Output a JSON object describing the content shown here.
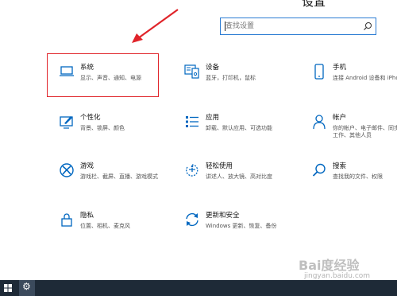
{
  "header": {
    "title_fragment": "设置"
  },
  "search": {
    "placeholder": "查找设置"
  },
  "categories": [
    {
      "title": "系统",
      "desc": "显示、声音、通知、电源",
      "icon": "laptop-icon"
    },
    {
      "title": "设备",
      "desc": "蓝牙，打印机，鼠标",
      "icon": "devices-icon"
    },
    {
      "title": "手机",
      "desc": "连接 Android 设备和 iPhone",
      "icon": "phone-icon"
    },
    {
      "title": "个性化",
      "desc": "背景、锁屏、颜色",
      "icon": "personalization-icon"
    },
    {
      "title": "应用",
      "desc": "卸载、默认应用、可选功能",
      "icon": "apps-icon"
    },
    {
      "title": "帐户",
      "desc": "你的帐户、电子邮件、同步设置、工作、其他人员",
      "icon": "account-icon"
    },
    {
      "title": "游戏",
      "desc": "游戏栏、截屏、直播、游戏模式",
      "icon": "xbox-icon"
    },
    {
      "title": "轻松使用",
      "desc": "讲述人、放大镜、高对比度",
      "icon": "ease-of-access-icon"
    },
    {
      "title": "搜索",
      "desc": "查找我的文件、权限",
      "icon": "search-icon"
    },
    {
      "title": "隐私",
      "desc": "位置、相机、麦克风",
      "icon": "lock-icon"
    },
    {
      "title": "更新和安全",
      "desc": "Windows 更新、恢复、备份",
      "icon": "update-icon"
    }
  ],
  "watermark": {
    "logo_text": "Bai度经验",
    "url": "jingyan.baidu.com"
  },
  "colors": {
    "accent": "#0067c0",
    "highlight": "#e0242a",
    "arrow": "#e0242a",
    "taskbar": "#1e2a37"
  }
}
